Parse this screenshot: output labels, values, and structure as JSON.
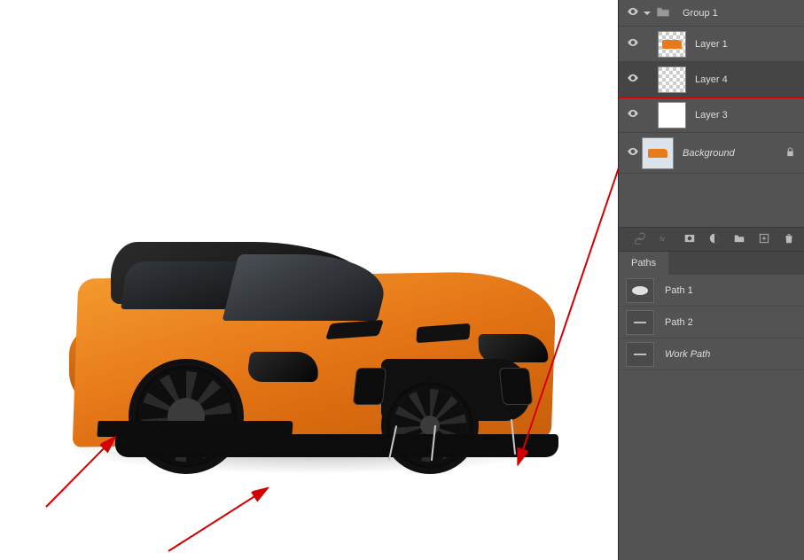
{
  "layers": {
    "group": {
      "name": "Group 1"
    },
    "items": [
      {
        "name": "Layer 1",
        "thumb": "car-transp"
      },
      {
        "name": "Layer 4",
        "thumb": "transp",
        "selected": true
      },
      {
        "name": "Layer 3",
        "thumb": "white"
      }
    ],
    "background": {
      "name": "Background",
      "locked": true
    }
  },
  "paths": {
    "tab_label": "Paths",
    "items": [
      {
        "name": "Path 1",
        "thumb": "blob"
      },
      {
        "name": "Path 2",
        "thumb": "line"
      },
      {
        "name": "Work Path",
        "thumb": "line",
        "italic": true
      }
    ]
  },
  "icon_bar": [
    "link",
    "fx",
    "mask",
    "adjust",
    "folder",
    "new",
    "trash"
  ]
}
